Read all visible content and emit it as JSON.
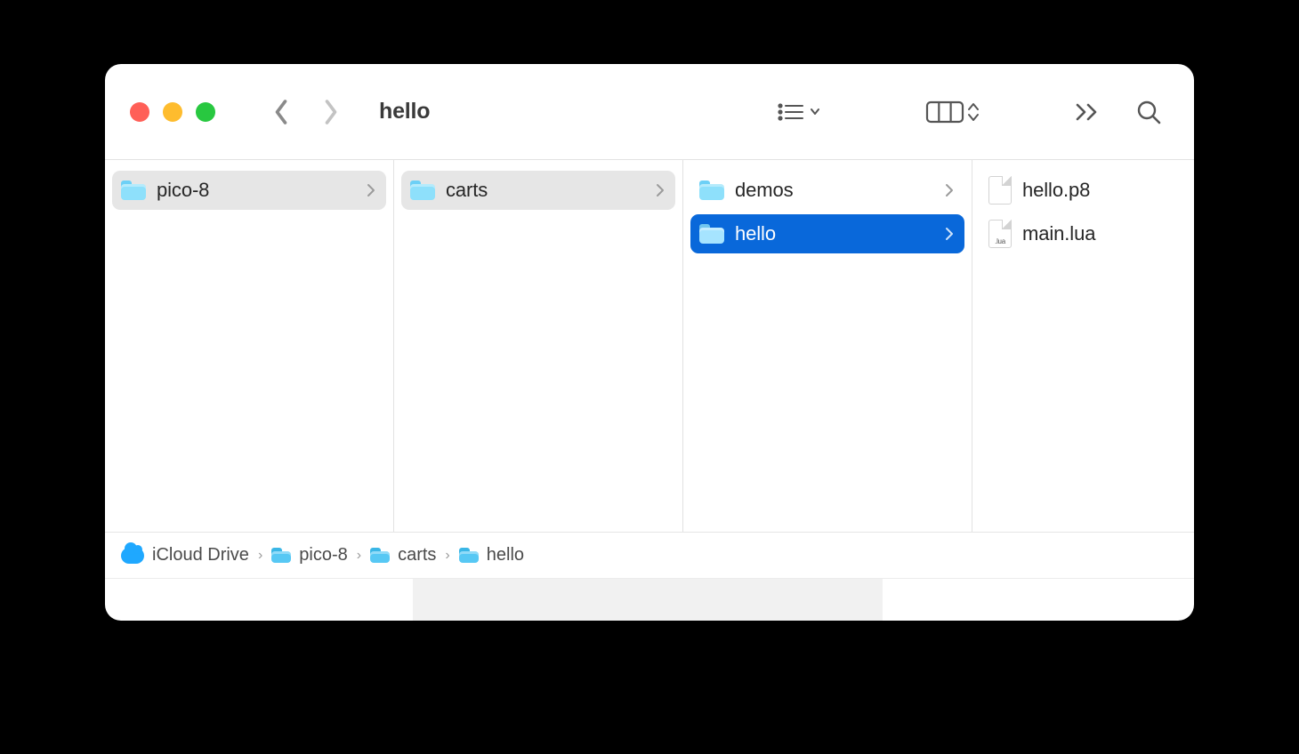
{
  "window_title": "hello",
  "columns": [
    {
      "items": [
        {
          "name": "pico-8",
          "type": "folder",
          "state": "gray"
        }
      ]
    },
    {
      "items": [
        {
          "name": "carts",
          "type": "folder",
          "state": "gray"
        }
      ]
    },
    {
      "items": [
        {
          "name": "demos",
          "type": "folder",
          "state": "none"
        },
        {
          "name": "hello",
          "type": "folder",
          "state": "blue"
        }
      ]
    },
    {
      "items": [
        {
          "name": "hello.p8",
          "type": "file-p8",
          "state": "none"
        },
        {
          "name": "main.lua",
          "type": "file-lua",
          "state": "none"
        }
      ]
    }
  ],
  "path": [
    {
      "name": "iCloud Drive",
      "icon": "cloud"
    },
    {
      "name": "pico-8",
      "icon": "folder"
    },
    {
      "name": "carts",
      "icon": "folder"
    },
    {
      "name": "hello",
      "icon": "folder"
    }
  ]
}
